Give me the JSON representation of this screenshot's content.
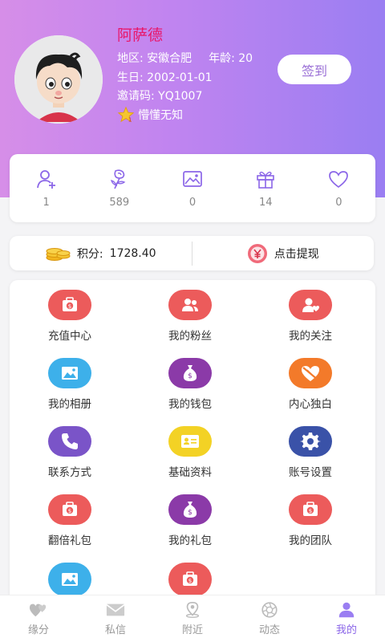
{
  "profile": {
    "name": "阿萨德",
    "region_label": "地区:",
    "region": "安徽合肥",
    "age_label": "年龄:",
    "age": "20",
    "birthday_label": "生日:",
    "birthday": "2002-01-01",
    "invite_label": "邀请码:",
    "invite_code": "YQ1007",
    "level_title": "懵懂无知",
    "checkin_label": "签到"
  },
  "stats": [
    {
      "icon": "add-user-icon",
      "value": "1"
    },
    {
      "icon": "rose-icon",
      "value": "589"
    },
    {
      "icon": "picture-icon",
      "value": "0"
    },
    {
      "icon": "gift-icon",
      "value": "14"
    },
    {
      "icon": "heart-icon",
      "value": "0"
    }
  ],
  "points": {
    "label": "积分:",
    "value": "1728.40",
    "withdraw_label": "点击提现"
  },
  "menu": [
    {
      "label": "充值中心",
      "icon": "wallet-icon",
      "color": "#ec5b5b"
    },
    {
      "label": "我的粉丝",
      "icon": "fans-icon",
      "color": "#ec5b5b"
    },
    {
      "label": "我的关注",
      "icon": "follow-icon",
      "color": "#ec5b5b"
    },
    {
      "label": "我的相册",
      "icon": "album-icon",
      "color": "#3db0ea"
    },
    {
      "label": "我的钱包",
      "icon": "money-bag-icon",
      "color": "#8b3aa8"
    },
    {
      "label": "内心独白",
      "icon": "broken-heart-icon",
      "color": "#f37a2a"
    },
    {
      "label": "联系方式",
      "icon": "phone-icon",
      "color": "#7a54c8"
    },
    {
      "label": "基础资料",
      "icon": "id-card-icon",
      "color": "#f3d225"
    },
    {
      "label": "账号设置",
      "icon": "gear-icon",
      "color": "#3a52a8"
    },
    {
      "label": "翻倍礼包",
      "icon": "wallet-icon",
      "color": "#ec5b5b"
    },
    {
      "label": "我的礼包",
      "icon": "money-bag-icon",
      "color": "#8b3aa8"
    },
    {
      "label": "我的团队",
      "icon": "wallet-icon",
      "color": "#ec5b5b"
    },
    {
      "label": "",
      "icon": "album-icon",
      "color": "#3db0ea"
    },
    {
      "label": "",
      "icon": "wallet-icon",
      "color": "#ec5b5b"
    }
  ],
  "tabs": [
    {
      "label": "缘分",
      "icon": "hearts-icon",
      "active": false
    },
    {
      "label": "私信",
      "icon": "mail-icon",
      "active": false
    },
    {
      "label": "附近",
      "icon": "location-icon",
      "active": false
    },
    {
      "label": "动态",
      "icon": "aperture-icon",
      "active": false
    },
    {
      "label": "我的",
      "icon": "user-icon",
      "active": true
    }
  ],
  "colors": {
    "accent": "#9a6fd6",
    "name": "#e8176a",
    "tab_active": "#8b66e8",
    "tab_inactive": "#999999"
  }
}
